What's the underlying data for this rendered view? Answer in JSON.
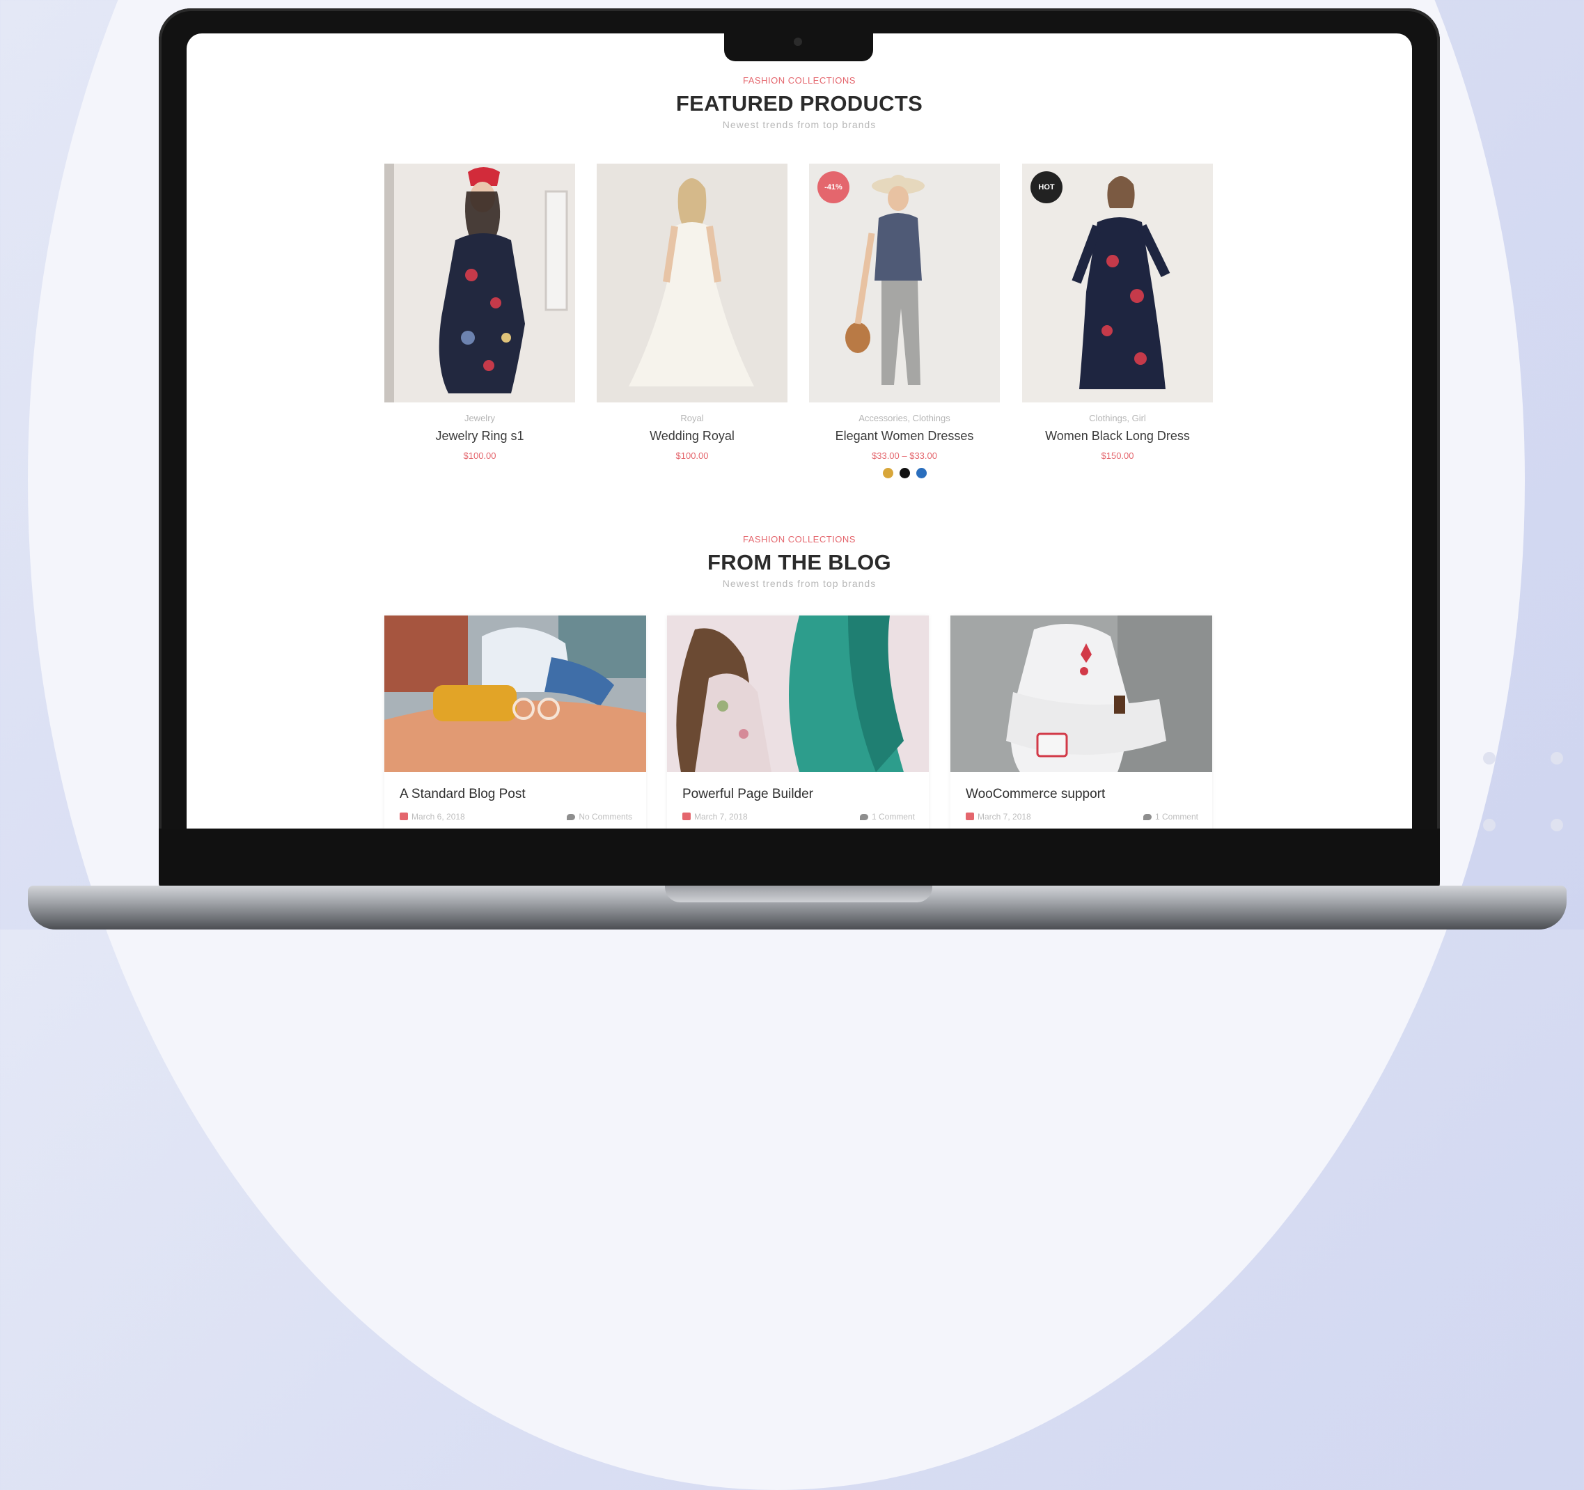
{
  "featured": {
    "eyebrow": "FASHION COLLECTIONS",
    "title": "FEATURED PRODUCTS",
    "subtitle": "Newest trends from top brands"
  },
  "products": [
    {
      "category": "Jewelry",
      "name": "Jewelry Ring s1",
      "price": "$100.00",
      "badge": ""
    },
    {
      "category": "Royal",
      "name": "Wedding Royal",
      "price": "$100.00",
      "badge": ""
    },
    {
      "category": "Accessories, Clothings",
      "name": "Elegant Women Dresses",
      "price": "$33.00 – $33.00",
      "badge": "-41%"
    },
    {
      "category": "Clothings, Girl",
      "name": "Women Black Long Dress",
      "price": "$150.00",
      "badge": "HOT"
    }
  ],
  "swatch_colors": [
    "#d8a63a",
    "#111111",
    "#2a6ebd"
  ],
  "blog": {
    "eyebrow": "FASHION COLLECTIONS",
    "title": "FROM THE BLOG",
    "subtitle": "Newest trends from top brands"
  },
  "posts": [
    {
      "title": "A Standard Blog Post",
      "date": "March 6, 2018",
      "comments": "No Comments"
    },
    {
      "title": "Powerful Page Builder",
      "date": "March 7, 2018",
      "comments": "1 Comment"
    },
    {
      "title": "WooCommerce support",
      "date": "March 7, 2018",
      "comments": "1 Comment"
    }
  ],
  "colors": {
    "accent": "#e4666d",
    "dark": "#222222"
  }
}
